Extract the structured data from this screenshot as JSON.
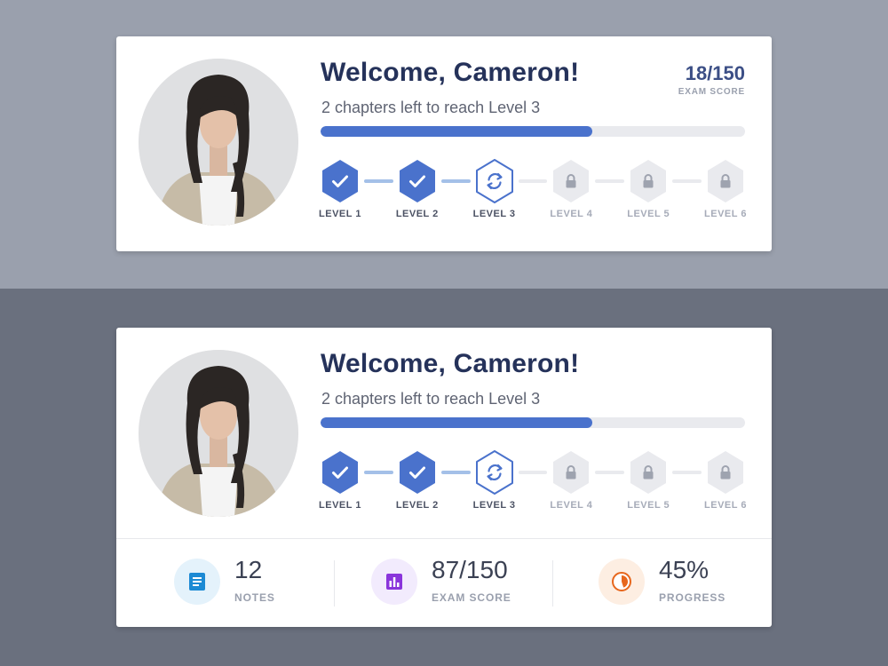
{
  "colors": {
    "accent": "#4a72cc",
    "title": "#25325a",
    "notes_icon": "#1c8ad4",
    "exam_icon": "#8a35db",
    "progress_icon": "#e7671d"
  },
  "card1": {
    "welcome": "Welcome, Cameron!",
    "subtitle": "2 chapters left to reach Level 3",
    "score": {
      "value": "18/150",
      "label": "EXAM SCORE"
    },
    "progress_fraction": 0.64,
    "levels": [
      {
        "label": "LEVEL 1",
        "state": "completed",
        "icon": "check-icon"
      },
      {
        "label": "LEVEL 2",
        "state": "completed",
        "icon": "check-icon"
      },
      {
        "label": "LEVEL 3",
        "state": "current",
        "icon": "refresh-icon"
      },
      {
        "label": "LEVEL 4",
        "state": "locked",
        "icon": "lock-icon"
      },
      {
        "label": "LEVEL 5",
        "state": "locked",
        "icon": "lock-icon"
      },
      {
        "label": "LEVEL 6",
        "state": "locked",
        "icon": "lock-icon"
      }
    ]
  },
  "card2": {
    "welcome": "Welcome, Cameron!",
    "subtitle": "2 chapters left to reach Level 3",
    "progress_fraction": 0.64,
    "levels": [
      {
        "label": "LEVEL 1",
        "state": "completed",
        "icon": "check-icon"
      },
      {
        "label": "LEVEL 2",
        "state": "completed",
        "icon": "check-icon"
      },
      {
        "label": "LEVEL 3",
        "state": "current",
        "icon": "refresh-icon"
      },
      {
        "label": "LEVEL 4",
        "state": "locked",
        "icon": "lock-icon"
      },
      {
        "label": "LEVEL 5",
        "state": "locked",
        "icon": "lock-icon"
      },
      {
        "label": "LEVEL 6",
        "state": "locked",
        "icon": "lock-icon"
      }
    ],
    "stats": [
      {
        "value": "12",
        "label": "NOTES",
        "icon": "notes-icon"
      },
      {
        "value": "87/150",
        "label": "EXAM SCORE",
        "icon": "bar-chart-icon"
      },
      {
        "value": "45%",
        "label": "PROGRESS",
        "icon": "pie-progress-icon",
        "fraction": 0.45
      }
    ]
  }
}
